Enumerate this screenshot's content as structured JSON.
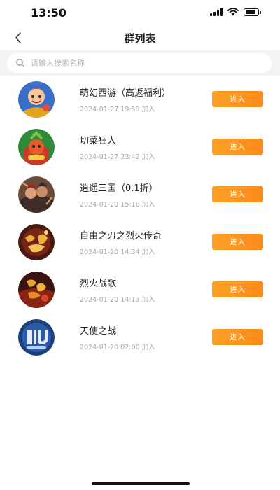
{
  "status_bar": {
    "time": "13:50"
  },
  "header": {
    "title": "群列表"
  },
  "search": {
    "placeholder": "请输入搜索名称",
    "value": ""
  },
  "colors": {
    "accent": "#ff8d1c",
    "meta_text": "#a8a8a8"
  },
  "groups": [
    {
      "name": "萌幻西游（高返福利）",
      "timestamp": "2024-01-27 19:59",
      "action_suffix": "加入",
      "button_label": "进入",
      "avatar_icon": "cartoon-hero-avatar"
    },
    {
      "name": "切菜狂人",
      "timestamp": "2024-01-27 23:42",
      "action_suffix": "加入",
      "button_label": "进入",
      "avatar_icon": "fruit-warrior-avatar"
    },
    {
      "name": "逍遥三国（0.1折）",
      "timestamp": "2024-01-20 15:16",
      "action_suffix": "加入",
      "button_label": "进入",
      "avatar_icon": "three-kingdoms-avatar"
    },
    {
      "name": "自由之刃之烈火传奇",
      "timestamp": "2024-01-20 14:34",
      "action_suffix": "加入",
      "button_label": "进入",
      "avatar_icon": "legend-logo-avatar"
    },
    {
      "name": "烈火战歌",
      "timestamp": "2024-01-20 14:13",
      "action_suffix": "加入",
      "button_label": "进入",
      "avatar_icon": "fire-war-avatar"
    },
    {
      "name": "天使之战",
      "timestamp": "2024-01-20 02:00",
      "action_suffix": "加入",
      "button_label": "进入",
      "avatar_icon": "angel-war-logo-avatar"
    }
  ]
}
